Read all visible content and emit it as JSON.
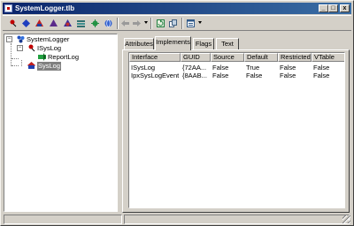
{
  "window": {
    "title": "SystemLogger.tlb"
  },
  "titlebar": {
    "minimize": "_",
    "maximize": "□",
    "close": "x"
  },
  "toolbar": {
    "buttons": [
      {
        "name": "pin-red-icon",
        "color": "#c00000"
      },
      {
        "name": "diamond-blue-icon",
        "color": "#1f3fbf"
      },
      {
        "name": "triangle-purple-icon",
        "color": "#5a2a8a"
      },
      {
        "name": "shapes-red-icon",
        "color": "#c02020"
      },
      {
        "name": "sphere-icon",
        "color": "#2060c0"
      },
      {
        "name": "stack-icon",
        "color": "#307070"
      },
      {
        "name": "gear-green-icon",
        "color": "#209040"
      },
      {
        "name": "globe-icon",
        "color": "#3060d0"
      },
      {
        "name": "back-icon",
        "color": "#808080"
      },
      {
        "name": "forward-icon",
        "color": "#808080"
      },
      {
        "name": "refresh-icon",
        "color": "#208040"
      },
      {
        "name": "copy-icon",
        "color": "#406080"
      },
      {
        "name": "view-icon",
        "color": "#305a8a"
      }
    ]
  },
  "tree": {
    "root": {
      "label": "SystemLogger",
      "expander": "−"
    },
    "child1": {
      "label": "ISysLog",
      "expander": "−"
    },
    "child1_item": {
      "label": "ReportLog"
    },
    "child2": {
      "label": "SysLog"
    }
  },
  "tabs": [
    "Attributes",
    "Implements",
    "Flags",
    "Text"
  ],
  "active_tab": "Implements",
  "table": {
    "columns": [
      "Interface",
      "GUID",
      "Source",
      "Default",
      "Restricted",
      "VTable"
    ],
    "rows": [
      [
        "ISysLog",
        "{72AA...",
        "False",
        "True",
        "False",
        "False"
      ],
      [
        "IpxSysLogEvent",
        "{8AAB...",
        "False",
        "False",
        "False",
        "False"
      ]
    ]
  }
}
